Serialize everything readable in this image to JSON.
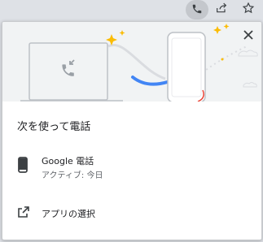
{
  "toolbar": {
    "icons": [
      "phone-icon",
      "share-icon",
      "bookmark-star-icon"
    ],
    "accent": "#c4c7cc"
  },
  "dialog": {
    "title": "次を使って電話",
    "close_icon": "close-icon",
    "device": {
      "name": "Google 電話",
      "status": "アクティブ: 今日",
      "icon": "smartphone-icon"
    },
    "open_app": {
      "label": "アプリの選択",
      "icon": "open-external-icon"
    }
  },
  "colors": {
    "accent_blue": "#4285f4",
    "sparkle_yellow": "#fbbc04",
    "hero_bg": "#f1f3f4",
    "accent_red": "#ea4335"
  }
}
